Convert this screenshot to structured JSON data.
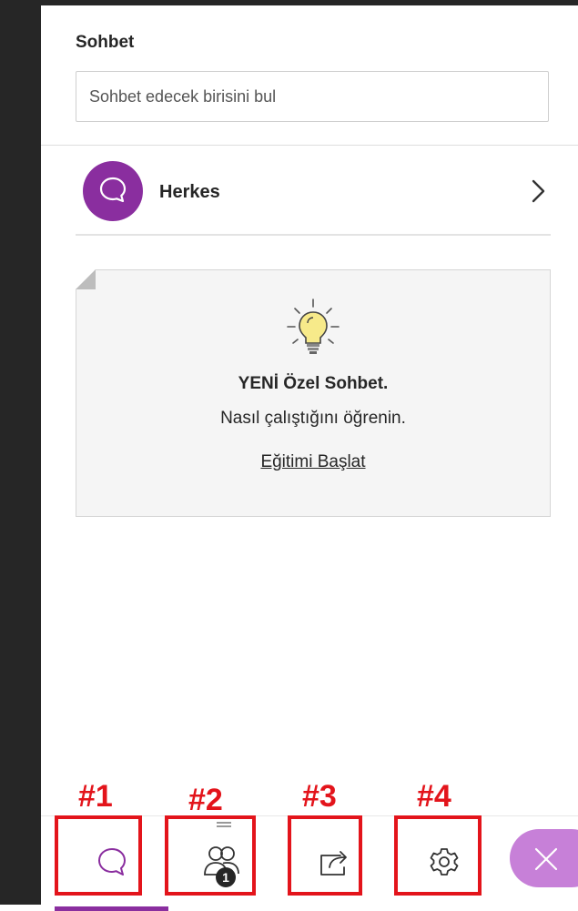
{
  "chat": {
    "title": "Sohbet",
    "search_placeholder": "Sohbet edecek birisini bul",
    "everyone_label": "Herkes"
  },
  "promo": {
    "title": "YENİ Özel Sohbet.",
    "subtitle": "Nasıl çalıştığını öğrenin.",
    "link": "Eğitimi Başlat"
  },
  "bottom_bar": {
    "tabs": [
      {
        "name": "chat",
        "icon": "chat-bubble-icon"
      },
      {
        "name": "participants",
        "icon": "people-icon",
        "badge": "1"
      },
      {
        "name": "share",
        "icon": "share-icon"
      },
      {
        "name": "settings",
        "icon": "gear-icon"
      }
    ],
    "close_icon": "close-icon"
  },
  "annotations": [
    "#1",
    "#2",
    "#3",
    "#4"
  ],
  "colors": {
    "accent": "#8a2e9f",
    "close_button": "#c780d8",
    "annotation": "#e3141b",
    "sidebar_dark": "#262626"
  }
}
